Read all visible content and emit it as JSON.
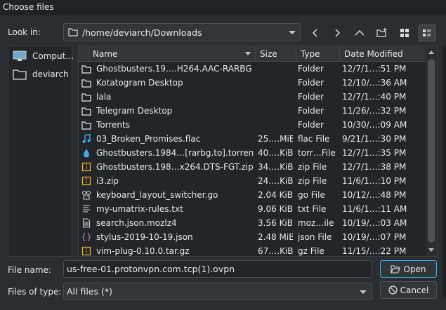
{
  "window": {
    "title": "Choose files"
  },
  "lookin": {
    "label": "Look in:",
    "path": "/home/deviarch/Downloads"
  },
  "toolbar": {
    "back": "back-arrow",
    "forward": "forward-arrow",
    "up": "up-arrow",
    "new_folder": "new-folder",
    "icon_view": "icon-view",
    "detail_view": "detail-view"
  },
  "sidebar": {
    "items": [
      {
        "label": "Comput…",
        "icon": "computer-icon"
      },
      {
        "label": "deviarch",
        "icon": "folder-icon"
      }
    ]
  },
  "columns": {
    "name": "Name",
    "size": "Size",
    "type": "Type",
    "date": "Date Modified"
  },
  "files": [
    {
      "name": "Ghostbusters.19….H264.AAC-RARBG",
      "size": "",
      "type": "Folder",
      "date": "12/7/1…:51 PM",
      "icon": "folder"
    },
    {
      "name": "Kotatogram Desktop",
      "size": "",
      "type": "Folder",
      "date": "12/10/…:36 AM",
      "icon": "folder"
    },
    {
      "name": "lala",
      "size": "",
      "type": "Folder",
      "date": "12/7/1…:40 PM",
      "icon": "folder"
    },
    {
      "name": "Telegram Desktop",
      "size": "",
      "type": "Folder",
      "date": "11/26/…:32 PM",
      "icon": "folder"
    },
    {
      "name": "Torrents",
      "size": "",
      "type": "Folder",
      "date": "10/30/…:09 AM",
      "icon": "folder"
    },
    {
      "name": "03_Broken_Promises.flac",
      "size": "25.…MiB",
      "type": "flac File",
      "date": "9/21/1…:30 PM",
      "icon": "audio"
    },
    {
      "name": "Ghostbusters.1984…[rarbg.to].torrent",
      "size": "40.…KiB",
      "type": "torr…File",
      "date": "12/7/1…:35 PM",
      "icon": "torrent"
    },
    {
      "name": "Ghostbusters.198…x264.DTS-FGT.zip",
      "size": "34.…KiB",
      "type": "zip File",
      "date": "12/7/1…:38 PM",
      "icon": "zip"
    },
    {
      "name": "i3.zip",
      "size": "24.…KiB",
      "type": "zip File",
      "date": "11/6/1…:10 PM",
      "icon": "zip"
    },
    {
      "name": "keyboard_layout_switcher.go",
      "size": "2.04 KiB",
      "type": "go File",
      "date": "10/12/…:48 PM",
      "icon": "go"
    },
    {
      "name": "my-umatrix-rules.txt",
      "size": "9.06 KiB",
      "type": "txt File",
      "date": "11/6/1…:11 AM",
      "icon": "text"
    },
    {
      "name": "search.json.mozlz4",
      "size": "3.56 KiB",
      "type": "moz…ile",
      "date": "10/19/…:03 AM",
      "icon": "doc"
    },
    {
      "name": "stylus-2019-10-19.json",
      "size": "2.48 MiB",
      "type": "json File",
      "date": "10/19/…:07 PM",
      "icon": "json"
    },
    {
      "name": "vim-plug-0.10.0.tar.gz",
      "size": "67.…KiB",
      "type": "gz File",
      "date": "11/15/…:22 PM",
      "icon": "zip"
    }
  ],
  "filename": {
    "label": "File name:",
    "value": "us-free-01.protonvpn.com.tcp(1).ovpn"
  },
  "filetype": {
    "label": "Files of type:",
    "value": "All files (*)"
  },
  "buttons": {
    "open": "Open",
    "cancel": "Cancel"
  },
  "colors": {
    "background": "#2a2e32",
    "view": "#232629",
    "accent": "#3daee9",
    "folder": "#e8e8e8",
    "audio": "#3daee9",
    "zip": "#f0b429"
  }
}
